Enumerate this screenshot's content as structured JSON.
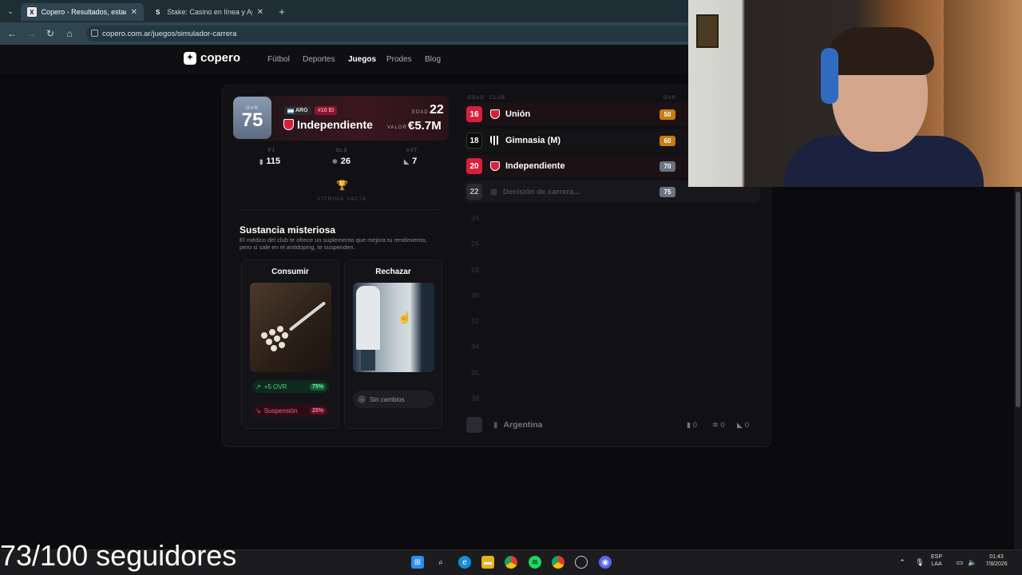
{
  "browser": {
    "tabs": [
      {
        "title": "Copero - Resultados, estadística",
        "fav": "X",
        "active": true
      },
      {
        "title": "Stake: Casino en línea y Apuesta",
        "fav": "S",
        "active": false
      }
    ],
    "new_tab": "+",
    "url": "copero.com.ar/juegos/simulador-carrera"
  },
  "site": {
    "logo": "copero",
    "nav": [
      "Fútbol",
      "Deportes",
      "Juegos",
      "Prodes",
      "Blog"
    ],
    "active_nav": "Juegos"
  },
  "player": {
    "ovr_label": "OVR",
    "ovr": "75",
    "country": "ARG",
    "number_tag": "#10 EI",
    "club": "Independiente",
    "edad_label": "EDAD",
    "edad": "22",
    "valor_label": "VALOR",
    "valor": "€5.7M",
    "stats": [
      {
        "label": "PJ",
        "value": "115",
        "icon": "shirt-icon"
      },
      {
        "label": "GLS",
        "value": "26",
        "icon": "ball-icon"
      },
      {
        "label": "AST",
        "value": "7",
        "icon": "boot-icon"
      }
    ],
    "vitrina": "VITRINA VACÍA"
  },
  "event": {
    "title": "Sustancia misteriosa",
    "description": "El médico del club te ofrece un suplemento que mejora tu rendimiento, pero si sale en el antidoping, te suspenden.",
    "options": [
      {
        "title": "Consumir",
        "effects": [
          {
            "text": "+5 OVR",
            "pct": "75%",
            "kind": "good"
          },
          {
            "text": "Suspensión",
            "pct": "25%",
            "kind": "bad"
          }
        ]
      },
      {
        "title": "Rechazar",
        "effects": [
          {
            "text": "Sin cambios",
            "kind": "neutral"
          }
        ]
      }
    ]
  },
  "career": {
    "headers": {
      "edad": "EDAD",
      "club": "CLUB",
      "ovr": "OVR"
    },
    "rows": [
      {
        "age": "16",
        "club": "Unión",
        "ovr": "50",
        "age_color": "#d6203c",
        "ovr_color": "#c77d12",
        "crest_color": "#d6203c"
      },
      {
        "age": "18",
        "club": "Gimnasia (M)",
        "ovr": "60",
        "age_color": "#111114",
        "ovr_color": "#c77d12",
        "crest_color": "#ffffff"
      },
      {
        "age": "20",
        "club": "Independiente",
        "ovr": "70",
        "age_color": "#d6203c",
        "ovr_color": "#6b7280",
        "crest_color": "#d6203c"
      },
      {
        "age": "22",
        "club": "Decisión de carrera...",
        "ovr": "75",
        "age_color": "#2a2a30",
        "ovr_color": "#6b7280",
        "crest_color": "#333338"
      }
    ],
    "empty_ages": [
      "24",
      "26",
      "28",
      "30",
      "32",
      "34",
      "36",
      "38"
    ],
    "national": {
      "team": "Argentina",
      "pj": "0",
      "gls": "0",
      "ast": "0"
    }
  },
  "overlay_text": "73/100 seguidores",
  "tray": {
    "lang1": "ESP",
    "lang2": "LAA",
    "time": "01:43",
    "date": "7/8/2026"
  },
  "colors": {
    "accent": "#d6203c",
    "good": "#4ad48a",
    "bad": "#ff5a7e"
  }
}
